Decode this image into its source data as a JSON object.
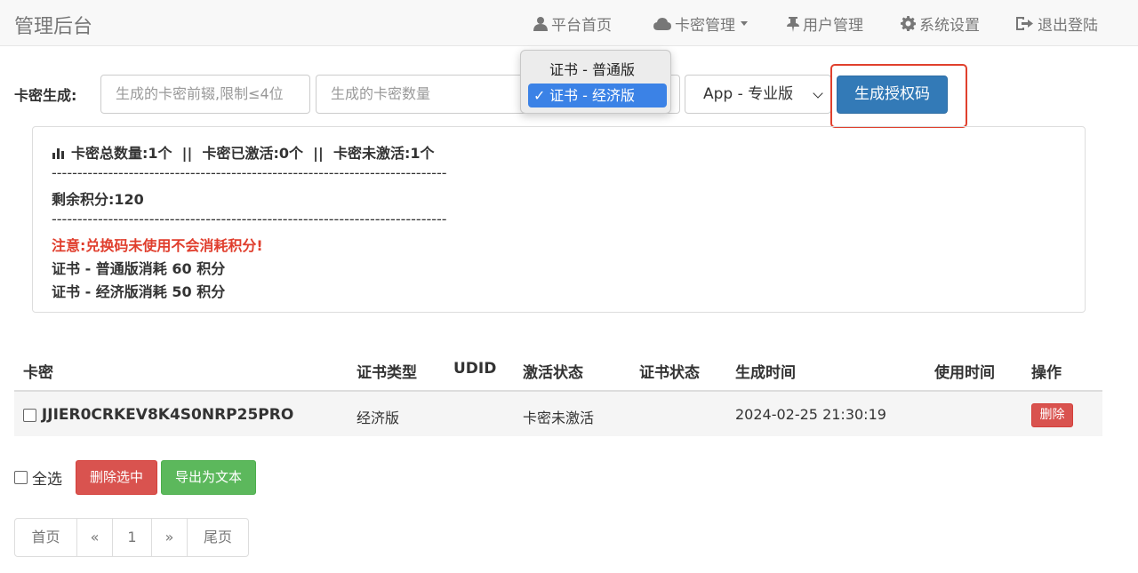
{
  "brand": "管理后台",
  "nav": {
    "home": "平台首页",
    "cards": "卡密管理",
    "users": "用户管理",
    "settings": "系统设置",
    "logout": "退出登陆"
  },
  "form": {
    "label": "卡密生成:",
    "prefix_placeholder": "生成的卡密前辍,限制≤4位",
    "count_placeholder": "生成的卡密数量",
    "cert_type_options": [
      "证书 - 普通版",
      "证书 - 经济版"
    ],
    "cert_type_selected": "证书 - 经济版",
    "app_type_selected": "App - 专业版",
    "generate_button": "生成授权码"
  },
  "info": {
    "stats": "卡密总数量:1个  ||  卡密已激活:0个  ||  卡密未激活:1个",
    "divider": "-----------------------------------------------------------------------------",
    "points": "剩余积分:120",
    "notice": "注意:兑换码未使用不会消耗积分!",
    "cost_normal": "证书 - 普通版消耗 60 积分",
    "cost_economy": "证书 - 经济版消耗 50 积分"
  },
  "table": {
    "headers": [
      "卡密",
      "证书类型",
      "UDID",
      "激活状态",
      "证书状态",
      "生成时间",
      "使用时间",
      "操作"
    ],
    "rows": [
      {
        "code": "JJIER0CRKEV8K4S0NRP25PRO",
        "cert_type": "经济版",
        "udid": "",
        "activation": "卡密未激活",
        "cert_status": "",
        "created": "2024-02-25 21:30:19",
        "used": "",
        "action": "删除"
      }
    ]
  },
  "bulk": {
    "select_all": "全选",
    "delete_selected": "删除选中",
    "export_text": "导出为文本"
  },
  "pagination": {
    "first": "首页",
    "prev": "«",
    "page": "1",
    "next": "»",
    "last": "尾页"
  },
  "colors": {
    "primary": "#337ab7",
    "danger": "#d9534f",
    "success": "#5cb85c",
    "highlight": "#e0402d",
    "notice": "#e03e2d"
  }
}
